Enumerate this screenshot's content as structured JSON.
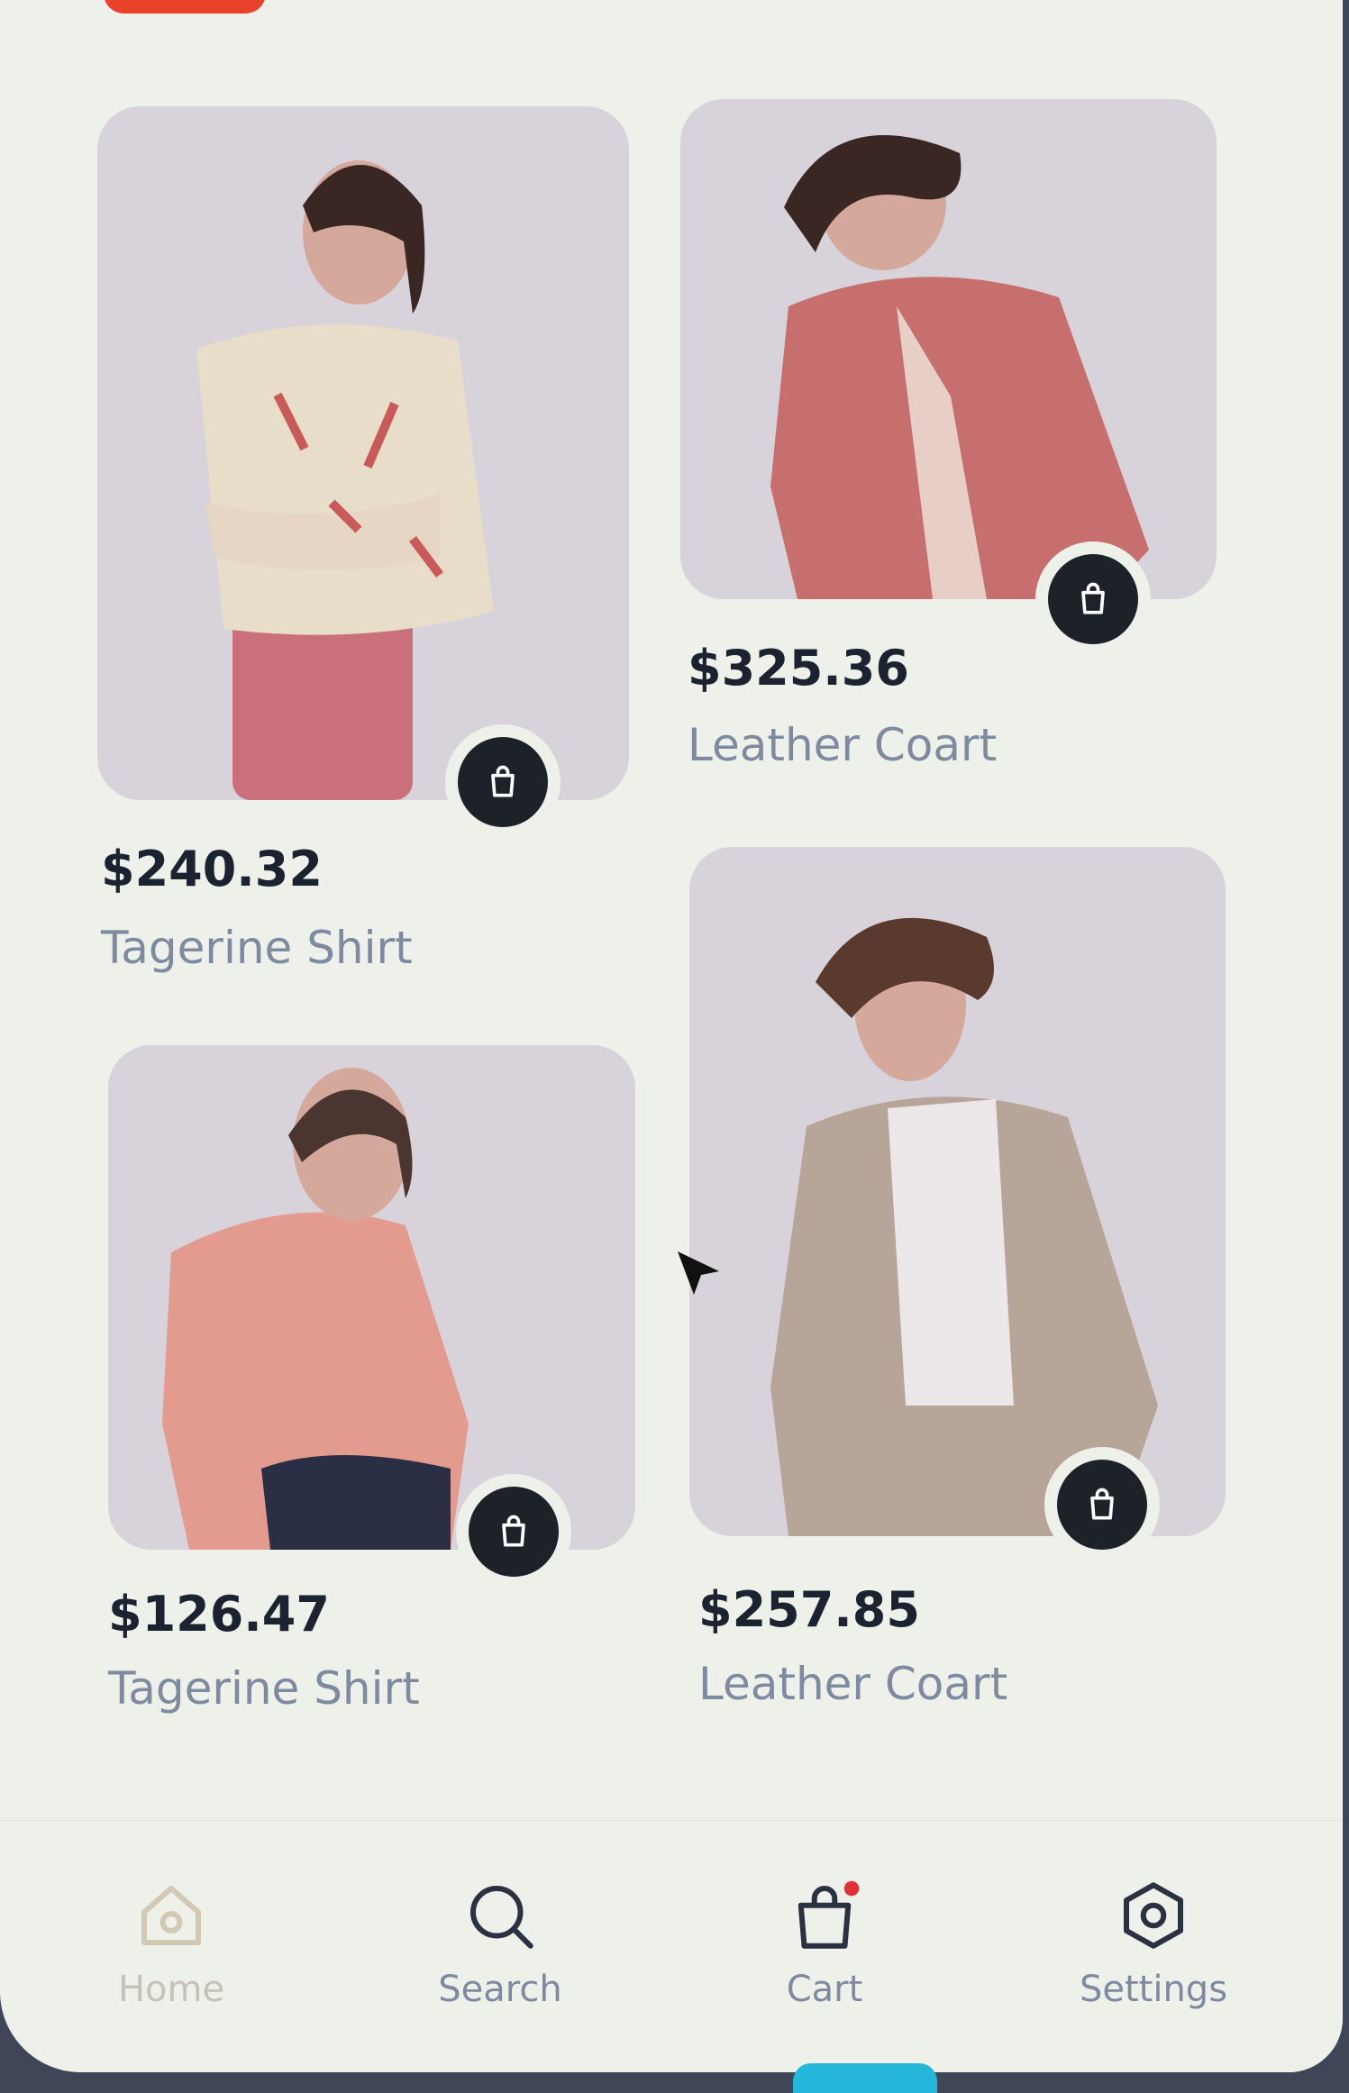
{
  "products": [
    {
      "price": "$240.32",
      "name": "Tagerine Shirt",
      "shirt_color": "#e7ddc8",
      "pants_color": "#c9707a"
    },
    {
      "price": "$325.36",
      "name": "Leather Coart",
      "shirt_color": "#c76f6e",
      "pants_color": "#b35e5f"
    },
    {
      "price": "$126.47",
      "name": "Tagerine Shirt",
      "shirt_color": "#e39a8f",
      "pants_color": "#2b2f45"
    },
    {
      "price": "$257.85",
      "name": "Leather Coart",
      "shirt_color": "#b8a59a",
      "pants_color": "#a89185"
    }
  ],
  "nav": {
    "home_label": "Home",
    "search_label": "Search",
    "cart_label": "Cart",
    "settings_label": "Settings"
  },
  "colors": {
    "accent_dark": "#1c2227",
    "price_text": "#1c2330",
    "name_text": "#7e8aa0",
    "badge_red": "#e8432a",
    "cart_dot": "#e0303a"
  }
}
